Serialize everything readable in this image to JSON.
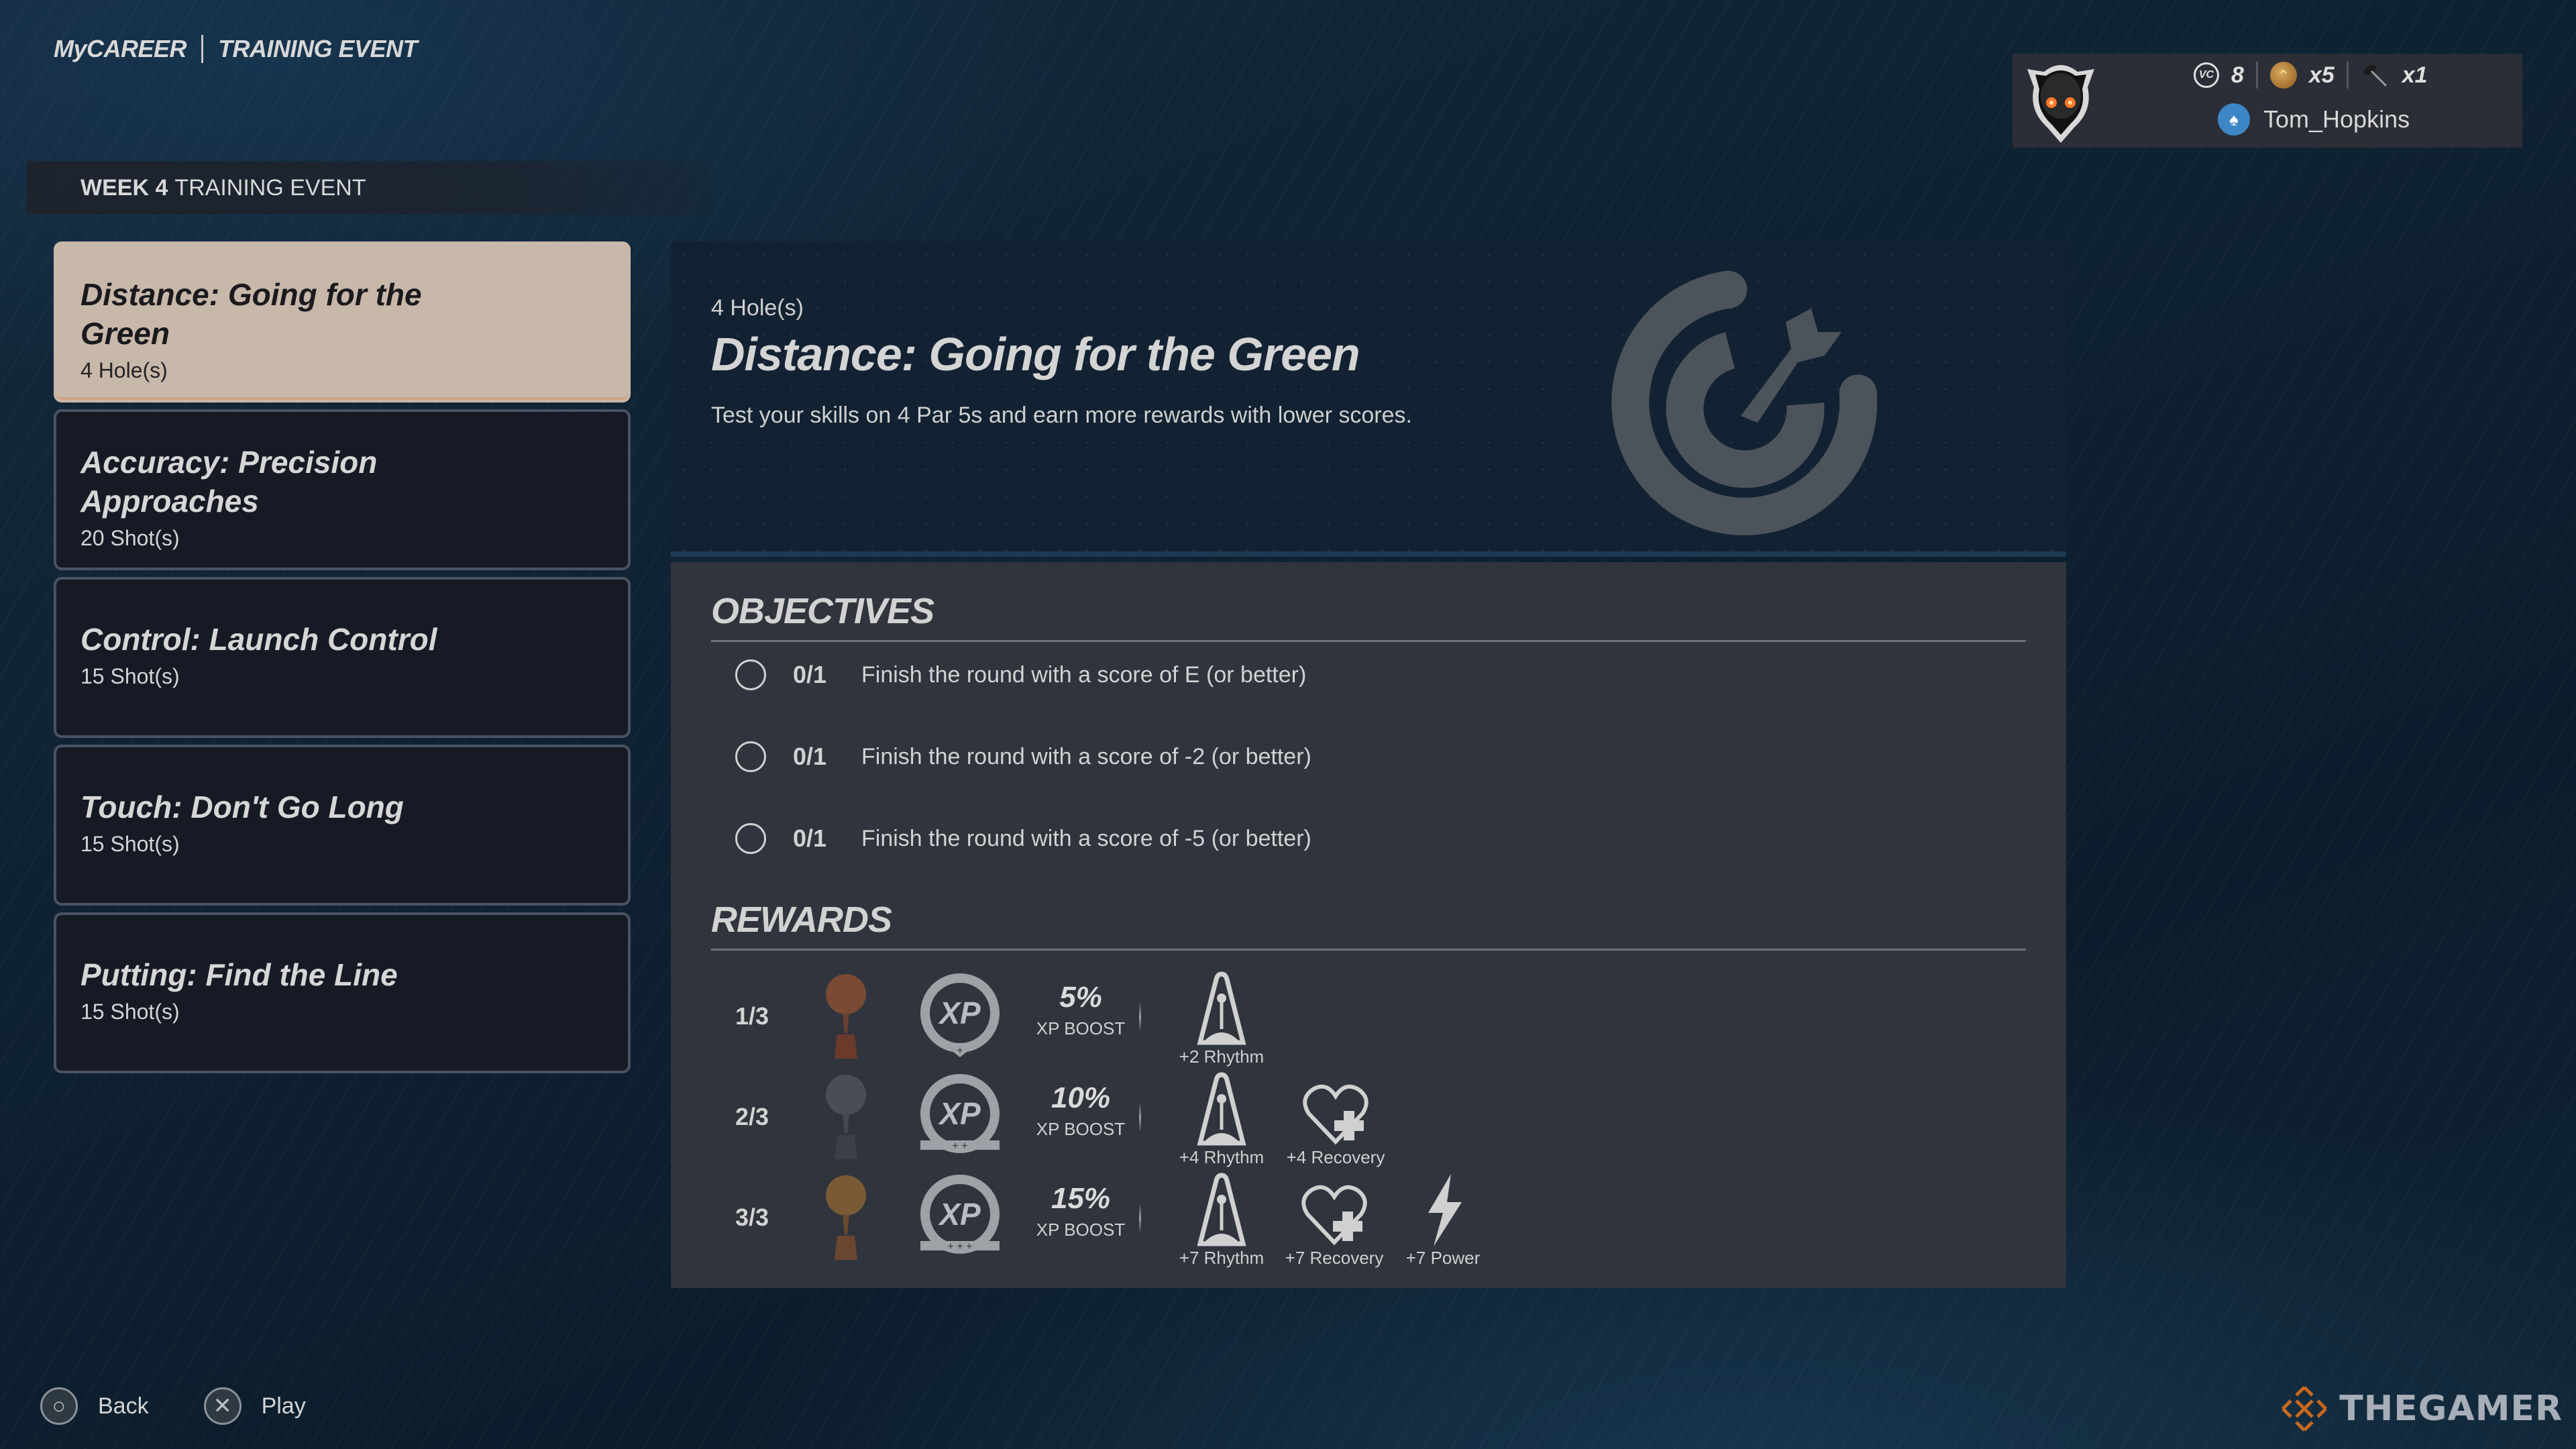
{
  "header": {
    "breadcrumb": [
      "MyCAREER",
      "TRAINING EVENT"
    ],
    "week_bold": "WEEK 4",
    "week_rest": "TRAINING EVENT"
  },
  "profile": {
    "avatar_icon": "helmet-avatar-icon",
    "vc_label": "VC",
    "vc_amount": "8",
    "medal_amount": "x5",
    "tool_amount": "x1",
    "platform_icon": "playstation-icon",
    "username": "Tom_Hopkins"
  },
  "events": [
    {
      "title": "Distance: Going for the Green",
      "subtitle": "4 Hole(s)",
      "selected": true
    },
    {
      "title": "Accuracy: Precision Approaches",
      "subtitle": "20 Shot(s)",
      "selected": false
    },
    {
      "title": "Control: Launch Control",
      "subtitle": "15 Shot(s)",
      "selected": false
    },
    {
      "title": "Touch: Don't Go Long",
      "subtitle": "15 Shot(s)",
      "selected": false
    },
    {
      "title": "Putting: Find the Line",
      "subtitle": "15 Shot(s)",
      "selected": false
    }
  ],
  "detail": {
    "count": "4 Hole(s)",
    "title": "Distance: Going for the Green",
    "description": "Test your skills on 4 Par 5s and earn more rewards with lower scores.",
    "icon": "target-arrow-icon",
    "objectives_heading": "OBJECTIVES",
    "objectives": [
      {
        "progress": "0/1",
        "text": "Finish the round with a score of E (or better)",
        "completed": false
      },
      {
        "progress": "0/1",
        "text": "Finish the round with a score of -2 (or better)",
        "completed": false
      },
      {
        "progress": "0/1",
        "text": "Finish the round with a score of -5 (or better)",
        "completed": false
      }
    ],
    "rewards_heading": "REWARDS",
    "rewards": [
      {
        "tier": "1/3",
        "trophy": "bronze",
        "xp_pct": "5%",
        "xp_label": "XP BOOST",
        "attributes": [
          {
            "icon": "metronome-icon",
            "label": "+2 Rhythm"
          }
        ]
      },
      {
        "tier": "2/3",
        "trophy": "silver",
        "xp_pct": "10%",
        "xp_label": "XP BOOST",
        "attributes": [
          {
            "icon": "metronome-icon",
            "label": "+4 Rhythm"
          },
          {
            "icon": "heart-plus-icon",
            "label": "+4 Recovery"
          }
        ]
      },
      {
        "tier": "3/3",
        "trophy": "gold",
        "xp_pct": "15%",
        "xp_label": "XP BOOST",
        "attributes": [
          {
            "icon": "metronome-icon",
            "label": "+7 Rhythm"
          },
          {
            "icon": "heart-plus-icon",
            "label": "+7 Recovery"
          },
          {
            "icon": "lightning-icon",
            "label": "+7 Power"
          }
        ]
      }
    ]
  },
  "footer": {
    "back_label": "Back",
    "play_label": "Play"
  },
  "watermark": "THEGAMER",
  "colors": {
    "selected_card": "#c8b8aa",
    "card_bg": "#161a25",
    "panel_bg": "#30343d",
    "bronze": "#7a4a34",
    "silver": "#4a4d55",
    "gold": "#7a5a34"
  }
}
